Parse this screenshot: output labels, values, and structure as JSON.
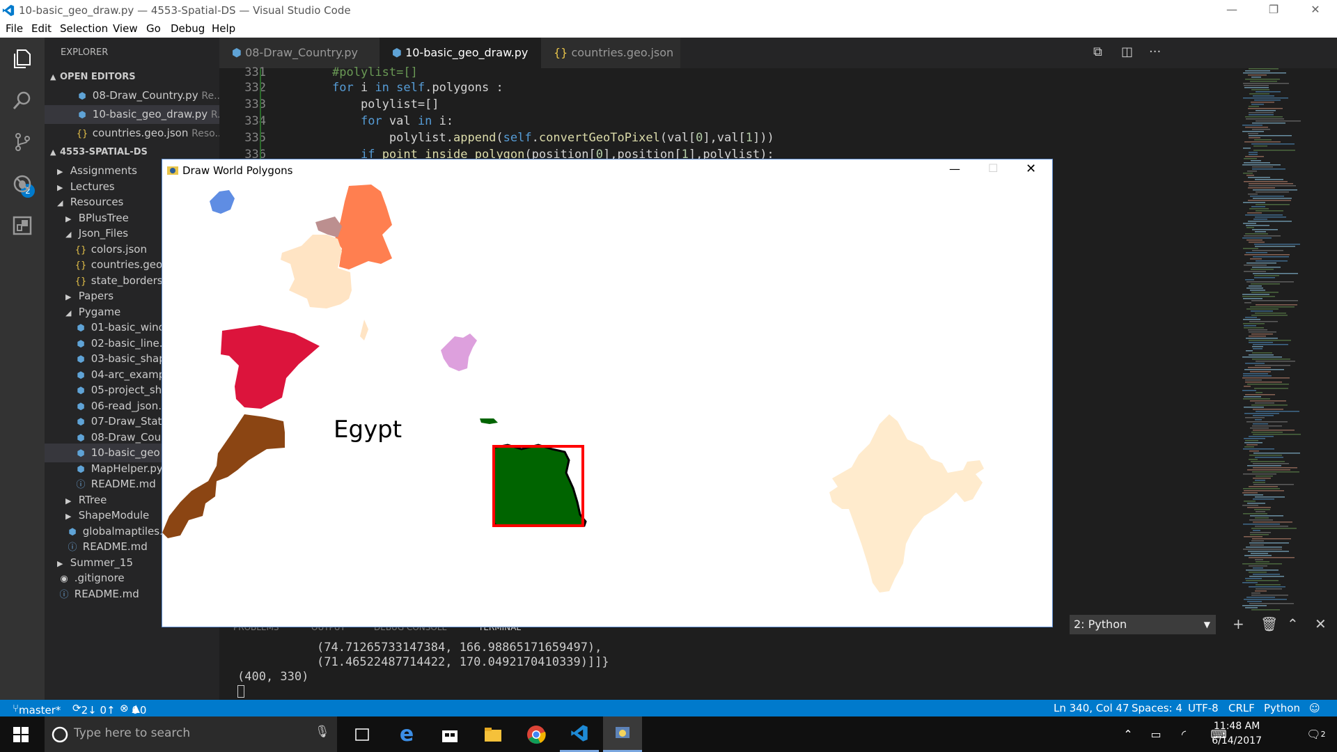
{
  "window": {
    "title": "10-basic_geo_draw.py — 4553-Spatial-DS — Visual Studio Code",
    "controls": [
      "—",
      "❐",
      "✕"
    ]
  },
  "menu": [
    "File",
    "Edit",
    "Selection",
    "View",
    "Go",
    "Debug",
    "Help"
  ],
  "sidebar": {
    "header": "EXPLORER",
    "open_editors_label": "OPEN EDITORS",
    "open_editors": [
      {
        "name": "08-Draw_Country.py",
        "path": "Re..."
      },
      {
        "name": "10-basic_geo_draw.py",
        "path": "R..."
      },
      {
        "name": "countries.geo.json",
        "path": "Reso..."
      }
    ],
    "project_label": "4553-SPATIAL-DS",
    "tree": [
      {
        "label": "Assignments",
        "kind": "folder-closed",
        "level": 1
      },
      {
        "label": "Lectures",
        "kind": "folder-closed",
        "level": 1
      },
      {
        "label": "Resources",
        "kind": "folder-open",
        "level": 1
      },
      {
        "label": "BPlusTree",
        "kind": "folder-closed",
        "level": 2
      },
      {
        "label": "Json_Files",
        "kind": "folder-open",
        "level": 2
      },
      {
        "label": "colors.json",
        "kind": "json",
        "level": 3
      },
      {
        "label": "countries.geo",
        "kind": "json",
        "level": 3
      },
      {
        "label": "state_borders",
        "kind": "json",
        "level": 3
      },
      {
        "label": "Papers",
        "kind": "folder-closed",
        "level": 2
      },
      {
        "label": "Pygame",
        "kind": "folder-open",
        "level": 2
      },
      {
        "label": "01-basic_winc",
        "kind": "py",
        "level": 3
      },
      {
        "label": "02-basic_line.",
        "kind": "py",
        "level": 3
      },
      {
        "label": "03-basic_shap",
        "kind": "py",
        "level": 3
      },
      {
        "label": "04-arc_examp",
        "kind": "py",
        "level": 3
      },
      {
        "label": "05-project_sh",
        "kind": "py",
        "level": 3
      },
      {
        "label": "06-read_json.",
        "kind": "py",
        "level": 3
      },
      {
        "label": "07-Draw_Stat",
        "kind": "py",
        "level": 3
      },
      {
        "label": "08-Draw_Cou",
        "kind": "py",
        "level": 3
      },
      {
        "label": "10-basic_geo",
        "kind": "py",
        "level": 3,
        "selected": true
      },
      {
        "label": "MapHelper.py",
        "kind": "py",
        "level": 3
      },
      {
        "label": "README.md",
        "kind": "info",
        "level": 3
      },
      {
        "label": "RTree",
        "kind": "folder-closed",
        "level": 2
      },
      {
        "label": "ShapeModule",
        "kind": "folder-closed",
        "level": 2
      },
      {
        "label": "globalmaptiles.",
        "kind": "py",
        "level": 2
      },
      {
        "label": "README.md",
        "kind": "info",
        "level": 2
      },
      {
        "label": "Summer_15",
        "kind": "folder-closed",
        "level": 1
      },
      {
        "label": ".gitignore",
        "kind": "git",
        "level": 1
      },
      {
        "label": "README.md",
        "kind": "info",
        "level": 1
      }
    ],
    "scm_badge": "2"
  },
  "tabs": [
    {
      "label": "08-Draw_Country.py",
      "icon": "python-icon"
    },
    {
      "label": "10-basic_geo_draw.py",
      "icon": "python-icon",
      "active": true,
      "close": "✕"
    },
    {
      "label": "countries.geo.json",
      "icon": "json-icon"
    }
  ],
  "code": [
    {
      "num": "331",
      "text": "#polylist=[]"
    },
    {
      "num": "332",
      "text": "for i in self.polygons :"
    },
    {
      "num": "333",
      "text": "    polylist=[]"
    },
    {
      "num": "334",
      "text": "    for val in i:"
    },
    {
      "num": "335",
      "text": "        polylist.append(self.convertGeoToPixel(val[0],val[1]))"
    },
    {
      "num": "336",
      "text": "    if point_inside_polygon(position[0],position[1],polylist):"
    }
  ],
  "panel": {
    "tabs": [
      "PROBLEMS",
      "OUTPUT",
      "DEBUG CONSOLE",
      "TERMINAL"
    ],
    "terminal_select": "2: Python",
    "lines": [
      "(74.71265733147384, 166.98865171659497),",
      "(71.46522487714422, 170.0492170410339)]]}",
      "(400, 330)"
    ]
  },
  "status": {
    "branch": "master*",
    "sync": "2↓ 0↑",
    "errors": "0",
    "warnings": "0",
    "position": "Ln 340, Col 47",
    "spaces": "Spaces: 4",
    "encoding": "UTF-8",
    "eol": "CRLF",
    "language": "Python"
  },
  "pygame": {
    "title": "Draw World Polygons",
    "label": "Egypt",
    "colors": {
      "iceland": "#5f8de3",
      "germany": "#ff7f50",
      "belgium": "#bc8f8f",
      "france": "#ffe4c4",
      "spain": "#dc143c",
      "morocco": "#8b4513",
      "greece": "#dda0dd",
      "egypt": "#006400",
      "egypt_box": "#ff0000",
      "india": "#ffebcd"
    }
  },
  "taskbar": {
    "search_placeholder": "Type here to search",
    "time": "11:48 AM",
    "date": "6/14/2017",
    "notif": "2"
  }
}
